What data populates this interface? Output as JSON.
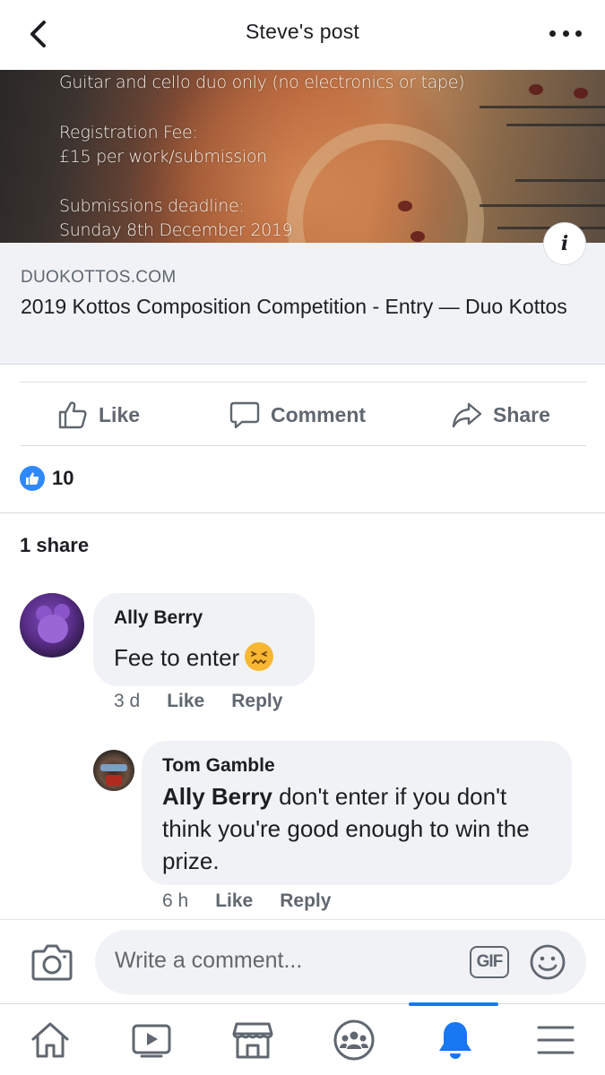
{
  "header": {
    "title": "Steve's post",
    "back_icon": "chevron-left-icon",
    "more_icon": "more-dots-icon"
  },
  "banner": {
    "lines": [
      "Guitar and cello duo only (no electronics or tape)",
      "Registration Fee:",
      "£15 per work/submission",
      "Submissions deadline:",
      "Sunday 8th December 2019"
    ],
    "info_label": "i"
  },
  "link": {
    "domain": "DUOKOTTOS.COM",
    "title": "2019 Kottos Composition Competition - Entry — Duo Kottos"
  },
  "actions": {
    "like": "Like",
    "comment": "Comment",
    "share": "Share"
  },
  "reactions": {
    "count": "10",
    "shares": "1 share",
    "reaction_color": "#2e89ff"
  },
  "comments": [
    {
      "author": "Ally Berry",
      "text": "Fee to enter",
      "emoji": "confounded-face",
      "time": "3 d",
      "like": "Like",
      "reply": "Reply"
    },
    {
      "author": "Tom Gamble",
      "mention": "Ally Berry",
      "text": " don't enter if you don't think you're good enough to win the prize.",
      "time": "6 h",
      "like": "Like",
      "reply": "Reply"
    }
  ],
  "composer": {
    "placeholder": "Write a comment...",
    "gif_label": "GIF"
  },
  "tabs": [
    {
      "name": "home",
      "icon": "home-icon"
    },
    {
      "name": "watch",
      "icon": "video-icon"
    },
    {
      "name": "marketplace",
      "icon": "store-icon"
    },
    {
      "name": "groups",
      "icon": "groups-icon"
    },
    {
      "name": "notifications",
      "icon": "bell-icon",
      "active": true
    },
    {
      "name": "menu",
      "icon": "menu-icon"
    }
  ],
  "colors": {
    "accent": "#1877f2",
    "secondary_text": "#606770",
    "bubble": "#f0f2f5"
  }
}
